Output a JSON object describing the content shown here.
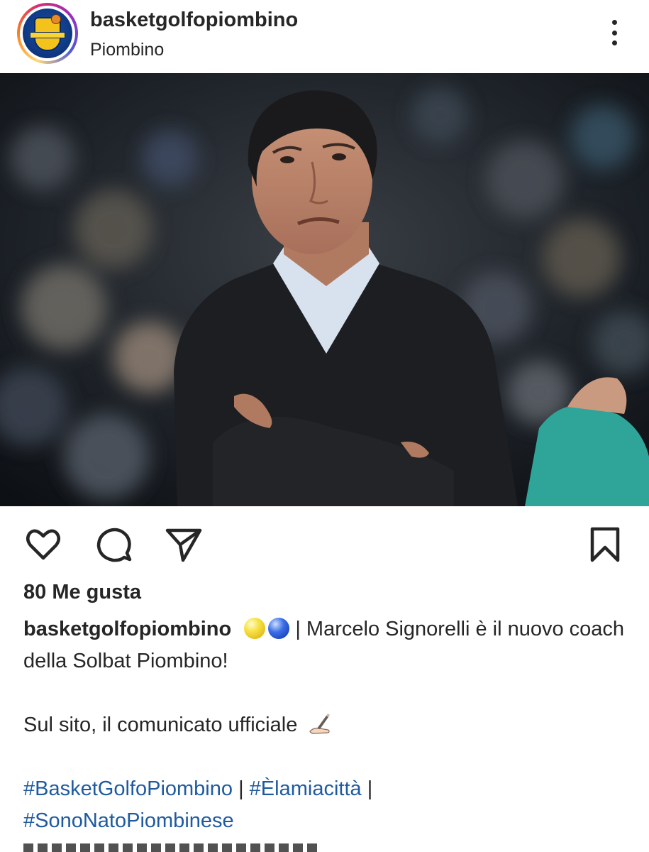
{
  "header": {
    "username": "basketgolfopiombino",
    "location": "Piombino",
    "avatar_icon": "basket-golfo-logo",
    "more_icon": "more-vertical-icon"
  },
  "post": {
    "image_icon": "coach-photo",
    "actions": {
      "like_icon": "heart-icon",
      "comment_icon": "comment-bubble-icon",
      "share_icon": "paper-plane-icon",
      "save_icon": "bookmark-icon"
    },
    "likes_text": "80 Me gusta",
    "caption": {
      "username": "basketgolfopiombino",
      "emoji_1": "yellow-ball-emoji",
      "emoji_2": "blue-ball-emoji",
      "line1": "| Marcelo Signorelli è il nuovo coach della Solbat Piombino!",
      "line2": "Sul sito, il comunicato ufficiale",
      "line2_emoji": "writing-hand-emoji",
      "hashtags": [
        "#BasketGolfoPiombino",
        "#Èlamiacittà",
        "#SonoNatoPiombinese"
      ],
      "hashtag_separator": "|"
    }
  },
  "colors": {
    "text": "#262626",
    "hashtag": "#1f5aa0",
    "background": "#ffffff"
  }
}
